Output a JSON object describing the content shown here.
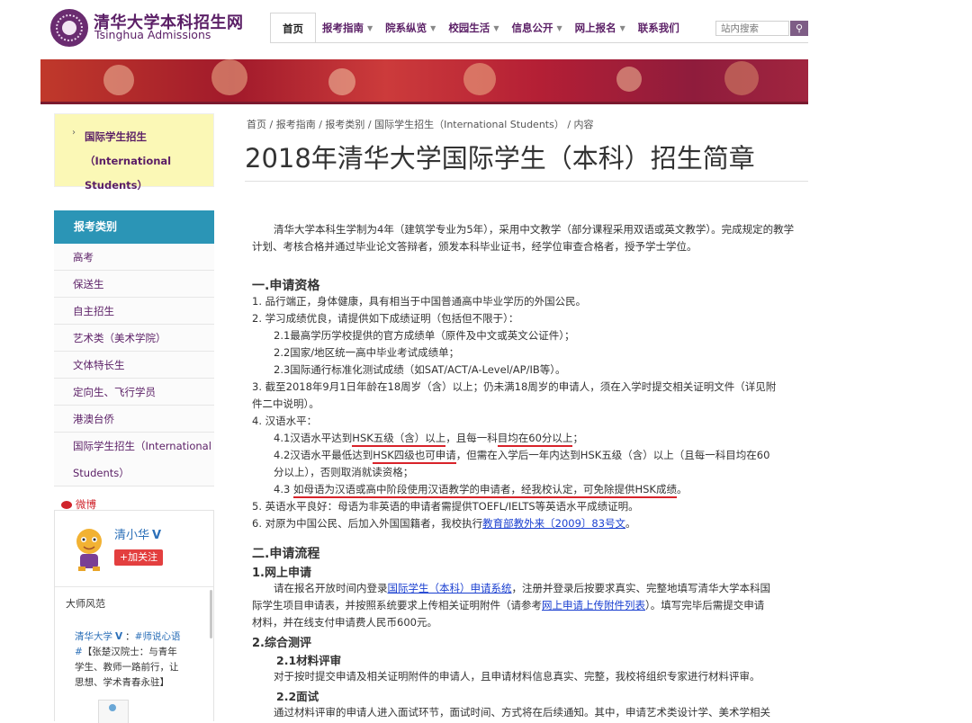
{
  "header": {
    "site_name": "清华大学本科招生网",
    "site_name_en": "Tsinghua Admissions",
    "nav": [
      {
        "label": "首页",
        "dropdown": false,
        "active": true
      },
      {
        "label": "报考指南",
        "dropdown": true
      },
      {
        "label": "院系纵览",
        "dropdown": true
      },
      {
        "label": "校园生活",
        "dropdown": true
      },
      {
        "label": "信息公开",
        "dropdown": true
      },
      {
        "label": "网上报名",
        "dropdown": true
      },
      {
        "label": "联系我们",
        "dropdown": false
      }
    ],
    "search_placeholder": "站内搜索",
    "search_icon": "search-icon"
  },
  "sidebar": {
    "current_section": "国际学生招生（International Students）",
    "category_header": "报考类别",
    "categories": [
      "高考",
      "保送生",
      "自主招生",
      "艺术类（美术学院）",
      "文体特长生",
      "定向生、飞行学员",
      "港澳台侨",
      "国际学生招生（International Students）"
    ],
    "weibo": {
      "label": "微博",
      "account": "清小华",
      "verified_mark": "V",
      "follow": "+加关注",
      "feed_title": "大师风范",
      "post_user": "清华大学",
      "post_tag": "#师说心语#",
      "post_text": "【张楚汉院士：与青年学生、教师一路前行，让思想、学术青春永驻】"
    }
  },
  "breadcrumb": "首页 / 报考指南 / 报考类别 / 国际学生招生（International Students） / 内容",
  "title": "2018年清华大学国际学生（本科）招生简章",
  "article": {
    "intro": "清华大学本科生学制为4年（建筑学专业为5年），采用中文教学（部分课程采用双语或英文教学）。完成规定的教学计划、考核合格并通过毕业论文答辩者，颁发本科毕业证书，经学位审查合格者，授予学士学位。",
    "section1_title": "一.申请资格",
    "s1_item1": "1. 品行端正，身体健康，具有相当于中国普通高中毕业学历的外国公民。",
    "s1_item2": "2. 学习成绩优良，请提供如下成绩证明（包括但不限于）：",
    "s1_item2_1": "2.1最高学历学校提供的官方成绩单（原件及中文或英文公证件）；",
    "s1_item2_2": "2.2国家/地区统一高中毕业考试成绩单；",
    "s1_item2_3": "2.3国际通行标准化测试成绩（如SAT/ACT/A-Level/AP/IB等）。",
    "s1_item3_line1": "3. 截至2018年9月1日年龄在18周岁（含）以上；仍未满18周岁的申请人，须在入学时提交相关证明文件（详见附",
    "s1_item3_line2": "件二中说明）。",
    "s1_item4": "4. 汉语水平：",
    "s1_item4_1_pre": "4.1汉语水平达到",
    "s1_item4_1_u1": "HSK五级（含）以上",
    "s1_item4_1_mid": "，且每一科",
    "s1_item4_1_u2": "目均在60分以上",
    "s1_item4_1_end": "；",
    "s1_item4_2_pre": "4.2汉语水平最低达到",
    "s1_item4_2_u": "HSK四级也可申请",
    "s1_item4_2_end": "，但需在入学后一年内达到HSK五级（含）以上（且每一科目均在60",
    "s1_item4_2_line2": "分以上），否则取消就读资格；",
    "s1_item4_3_pre": "4.3 ",
    "s1_item4_3_u": "如母语为汉语或高中阶段使用汉语教学的申请者，经我校认定，可免除提供HSK成绩",
    "s1_item4_3_end": "。",
    "s1_item5": "5. 英语水平良好：母语为非英语的申请者需提供TOEFL/IELTS等英语水平成绩证明。",
    "s1_item6_pre": "6. 对原为中国公民、后加入外国国籍者，我校执行",
    "s1_item6_link": "教育部教外来〔2009〕83号文",
    "s1_item6_end": "。",
    "section2_title": "二.申请流程",
    "s2_sub1": "1.网上申请",
    "s2_p1_l1_pre": "请在报名开放时间内登录",
    "s2_p1_l1_link": "国际学生（本科）申请系统",
    "s2_p1_l1_end": "，注册并登录后按要求真实、完整地填写清华大学本科国",
    "s2_p1_l2_pre": "际学生项目申请表，并按照系统要求上传相关证明附件（请参考",
    "s2_p1_l2_link": "网上申请上传附件列表",
    "s2_p1_l2_end": "）。填写完毕后需提交申请",
    "s2_p1_l3": "材料，并在线支付申请费人民币600元。",
    "s2_sub2": "2.综合测评",
    "s2_sub2_1": "2.1材料评审",
    "s2_p2": "对于按时提交申请及相关证明附件的申请人，且申请材料信息真实、完整，我校将组织专家进行材料评审。",
    "s2_sub2_2": "2.2面试",
    "s2_p3": "通过材料评审的申请人进入面试环节，面试时间、方式将在后续通知。其中，申请艺术类设计学、美术学相关"
  }
}
